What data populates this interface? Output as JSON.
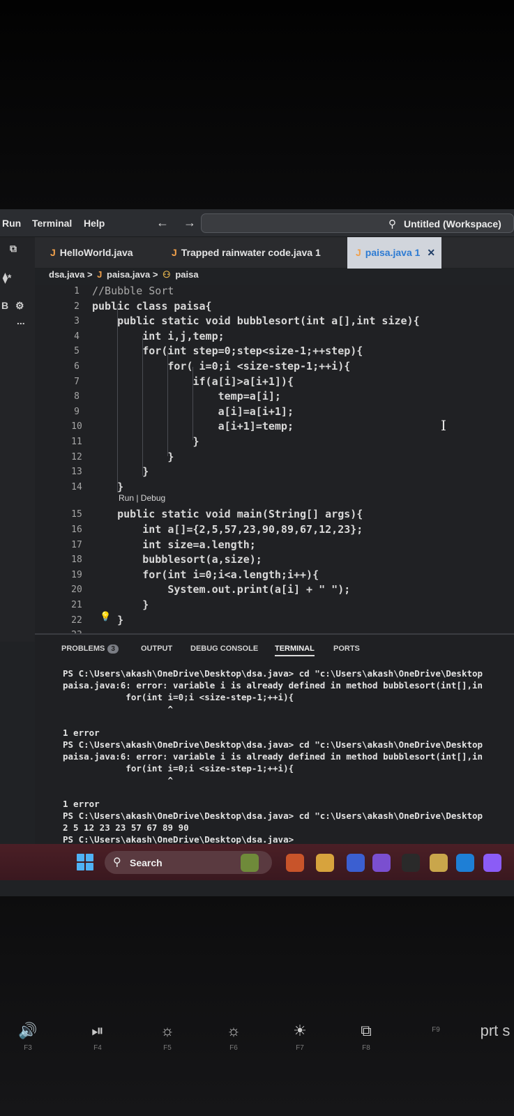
{
  "menu": [
    "Run",
    "Terminal",
    "Help"
  ],
  "nav": {
    "arrows": "← →"
  },
  "command_center": {
    "text": "Untitled (Workspace)"
  },
  "activity": {
    "git": "B",
    "more": "..."
  },
  "tabs": [
    {
      "label": "HelloWorld.java",
      "badge": ""
    },
    {
      "label": "Trapped rainwater code.java",
      "badge": "1"
    },
    {
      "label": "paisa.java",
      "badge": "1"
    }
  ],
  "tab_close": "✕",
  "breadcrumb": {
    "folder": "dsa.java",
    "file": "paisa.java",
    "symbol": "paisa"
  },
  "editor": {
    "line_numbers": [
      "1",
      "2",
      "3",
      "4",
      "5",
      "6",
      "7",
      "8",
      "9",
      "10",
      "11",
      "12",
      "13",
      "14",
      "15",
      "16",
      "17",
      "18",
      "19",
      "20",
      "21",
      "22",
      "23"
    ],
    "lines": [
      "//Bubble Sort",
      "public class paisa{",
      "    public static void bubblesort(int a[],int size){",
      "        int i,j,temp;",
      "        for(int step=0;step<size-1;++step){",
      "            for( i=0;i <size-step-1;++i){",
      "                if(a[i]>a[i+1]){",
      "                    temp=a[i];",
      "                    a[i]=a[i+1];",
      "                    a[i+1]=temp;",
      "                }",
      "            }",
      "        }",
      "    }",
      "    public static void main(String[] args){",
      "        int a[]={2,5,57,23,90,89,67,12,23};",
      "        int size=a.length;",
      "        bubblesort(a,size);",
      "        for(int i=0;i<a.length;i++){",
      "            System.out.print(a[i] + \" \");",
      "        }",
      "    }",
      ""
    ],
    "codelens": "Run | Debug"
  },
  "panel": {
    "tabs": [
      "PROBLEMS",
      "OUTPUT",
      "DEBUG CONSOLE",
      "TERMINAL",
      "PORTS"
    ],
    "problems_count": "3",
    "terminal_lines": [
      "PS C:\\Users\\akash\\OneDrive\\Desktop\\dsa.java> cd \"c:\\Users\\akash\\OneDrive\\Desktop",
      "paisa.java:6: error: variable i is already defined in method bubblesort(int[],in",
      "            for(int i=0;i <size-step-1;++i){",
      "                    ^",
      "",
      "1 error",
      "PS C:\\Users\\akash\\OneDrive\\Desktop\\dsa.java> cd \"c:\\Users\\akash\\OneDrive\\Desktop",
      "paisa.java:6: error: variable i is already defined in method bubblesort(int[],in",
      "            for(int i=0;i <size-step-1;++i){",
      "                    ^",
      "",
      "1 error",
      "PS C:\\Users\\akash\\OneDrive\\Desktop\\dsa.java> cd \"c:\\Users\\akash\\OneDrive\\Desktop",
      "2 5 12 23 23 57 67 89 90",
      "PS C:\\Users\\akash\\OneDrive\\Desktop\\dsa.java>"
    ]
  },
  "taskbar": {
    "search_label": "Search",
    "icons": [
      "widgets-icon",
      "store-game-icon",
      "file-explorer-icon",
      "teams-icon",
      "meet-icon",
      "dell-icon",
      "store-icon",
      "edge-icon",
      "copilot-icon"
    ]
  },
  "keyboard": {
    "keys": [
      {
        "symbol": "🔊",
        "label": "F3"
      },
      {
        "symbol": "⏯",
        "label": "F4"
      },
      {
        "symbol": "☼",
        "label": "F5"
      },
      {
        "symbol": "☼",
        "label": "F6"
      },
      {
        "symbol": "☀",
        "label": "F7"
      },
      {
        "symbol": "⧉",
        "label": "F8"
      },
      {
        "symbol": "",
        "label": "F9"
      },
      {
        "symbol": "prt s",
        "label": ""
      }
    ]
  },
  "colors": {
    "accent": "#2d7bd3",
    "keyword": "#7fb6f0",
    "taskbar": "#4b1f26"
  }
}
